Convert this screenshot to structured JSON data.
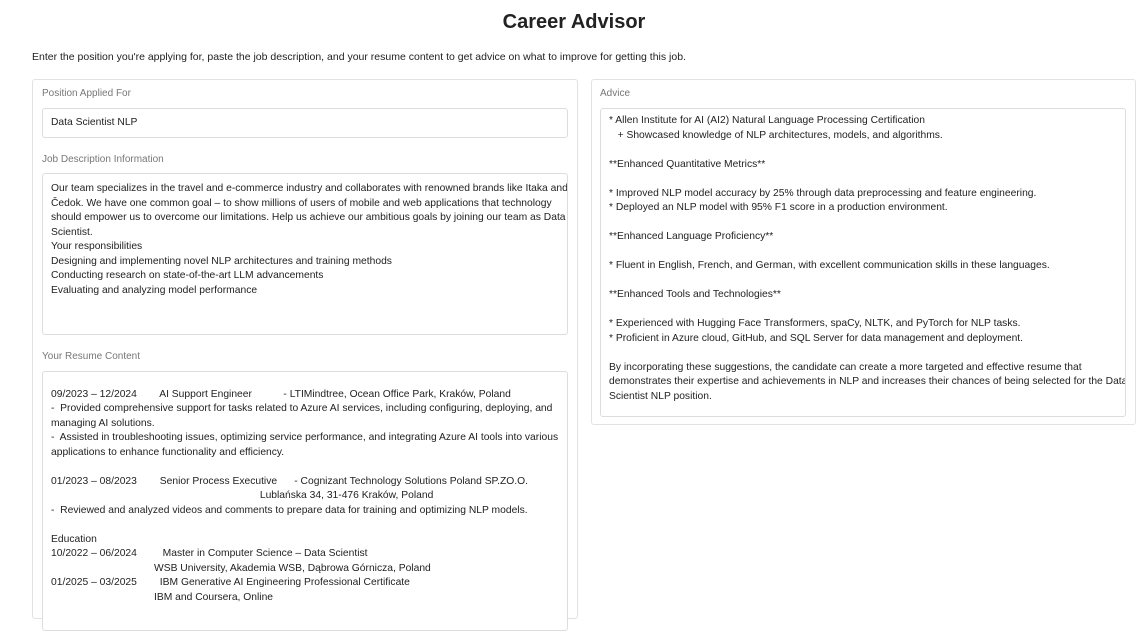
{
  "title": "Career Advisor",
  "intro": "Enter the position you're applying for, paste the job description, and your resume content to get advice on what to improve for getting this job.",
  "position": {
    "label": "Position Applied For",
    "value": "Data Scientist NLP"
  },
  "job": {
    "label": "Job Description Information",
    "lines": [
      "Our team specializes in the travel and e-commerce industry and collaborates with renowned brands like Itaka and",
      "Čedok. We have one common goal – to show millions of users of mobile and web applications that technology",
      "should empower us to overcome our limitations. Help us achieve our ambitious goals by joining our team as Data",
      "Scientist.",
      "Your responsibilities",
      "Designing and implementing novel NLP architectures and training methods",
      "Conducting research on state-of-the-art LLM advancements",
      "Evaluating and analyzing model performance"
    ]
  },
  "resume": {
    "label": "Your Resume Content",
    "lines": [
      "",
      "09/2023 – 12/2024        AI Support Engineer           - LTIMindtree, Ocean Office Park, Kraków, Poland",
      "-  Provided comprehensive support for tasks related to Azure AI services, including configuring, deploying, and",
      "managing AI solutions.",
      "-  Assisted in troubleshooting issues, optimizing service performance, and integrating Azure AI tools into various",
      "applications to enhance functionality and efficiency.",
      "",
      "01/2023 – 08/2023        Senior Process Executive      - Cognizant Technology Solutions Poland SP.ZO.O.",
      "                                                                         Lublańska 34, 31-476 Kraków, Poland",
      "-  Reviewed and analyzed videos and comments to prepare data for training and optimizing NLP models.",
      "",
      "Education",
      "10/2022 – 06/2024         Master in Computer Science – Data Scientist",
      "                                    WSB University, Akademia WSB, Dąbrowa Górnicza, Poland",
      "01/2025 – 03/2025        IBM Generative AI Engineering Professional Certificate",
      "                                    IBM and Coursera, Online"
    ]
  },
  "advice": {
    "label": "Advice",
    "lines": [
      "* Allen Institute for AI (AI2) Natural Language Processing Certification",
      "   + Showcased knowledge of NLP architectures, models, and algorithms.",
      "",
      "**Enhanced Quantitative Metrics**",
      "",
      "* Improved NLP model accuracy by 25% through data preprocessing and feature engineering.",
      "* Deployed an NLP model with 95% F1 score in a production environment.",
      "",
      "**Enhanced Language Proficiency**",
      "",
      "* Fluent in English, French, and German, with excellent communication skills in these languages.",
      "",
      "**Enhanced Tools and Technologies**",
      "",
      "* Experienced with Hugging Face Transformers, spaCy, NLTK, and PyTorch for NLP tasks.",
      "* Proficient in Azure cloud, GitHub, and SQL Server for data management and deployment.",
      "",
      "By incorporating these suggestions, the candidate can create a more targeted and effective resume that",
      "demonstrates their expertise and achievements in NLP and increases their chances of being selected for the Data",
      "Scientist NLP position."
    ]
  }
}
